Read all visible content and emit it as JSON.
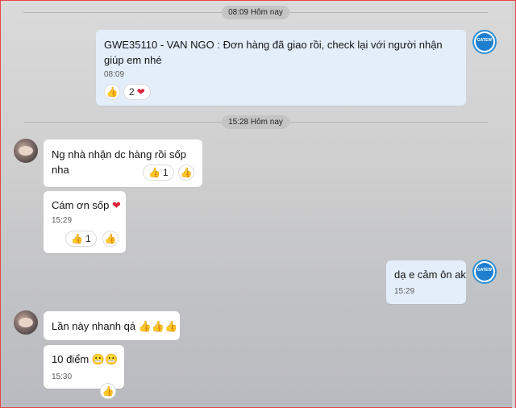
{
  "dividers": [
    {
      "label": "08:09 Hôm nay"
    },
    {
      "label": "15:28 Hôm nay"
    }
  ],
  "messages": [
    {
      "sender": "VAN NGO",
      "text": "GWE35110 - VAN NGO : Đơn hàng đã giao rồi, check lại với người nhận giúp em nhé",
      "time": "08:09",
      "reaction_count": "2"
    },
    {
      "text": "Ng nhà nhận dc hàng rồi sốp nha",
      "reaction_count": "1"
    },
    {
      "text": "Cám ơn sốp",
      "time": "15:29",
      "reaction_count": "1"
    },
    {
      "text": "dạ e cảm ôn ak",
      "time": "15:29"
    },
    {
      "text": "Lần này nhanh qá",
      "emojis": "👍👍👍"
    },
    {
      "text": "10 điểm",
      "emojis": "😬😬",
      "time": "15:30"
    }
  ],
  "icons": {
    "thumb": "👍",
    "heart": "❤",
    "grimace": "😬"
  },
  "colors": {
    "outgoing_bubble": "#e4eefb",
    "incoming_bubble": "#ffffff",
    "heart": "#d8243a",
    "brand_blue": "#1f7fcf"
  }
}
